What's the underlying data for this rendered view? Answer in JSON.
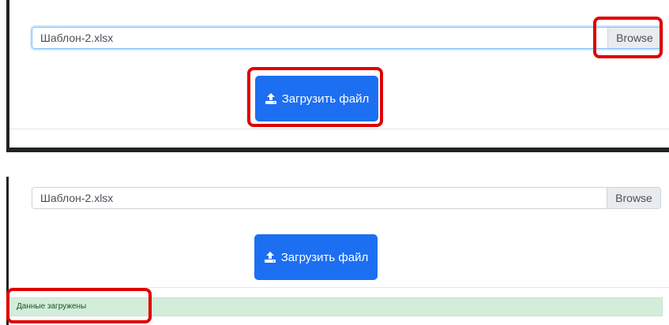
{
  "screens": [
    {
      "file_input": {
        "value": "Шаблон-2.xlsx",
        "browse_label": "Browse",
        "state": "focused"
      },
      "upload_button": {
        "label": "Загрузить файл",
        "icon": "upload-icon"
      },
      "highlights": [
        "browse-button",
        "upload-button"
      ]
    },
    {
      "file_input": {
        "value": "Шаблон-2.xlsx",
        "browse_label": "Browse",
        "state": "normal"
      },
      "upload_button": {
        "label": "Загрузить файл",
        "icon": "upload-icon"
      },
      "alert": {
        "text": "Данные загружены",
        "type": "success"
      },
      "highlights": [
        "success-alert"
      ]
    }
  ],
  "colors": {
    "primary": "#1d6ff2",
    "highlight": "#e00000",
    "alert_success_bg": "#d4edda",
    "alert_success_text": "#155724",
    "panel_border": "#1f2326"
  }
}
